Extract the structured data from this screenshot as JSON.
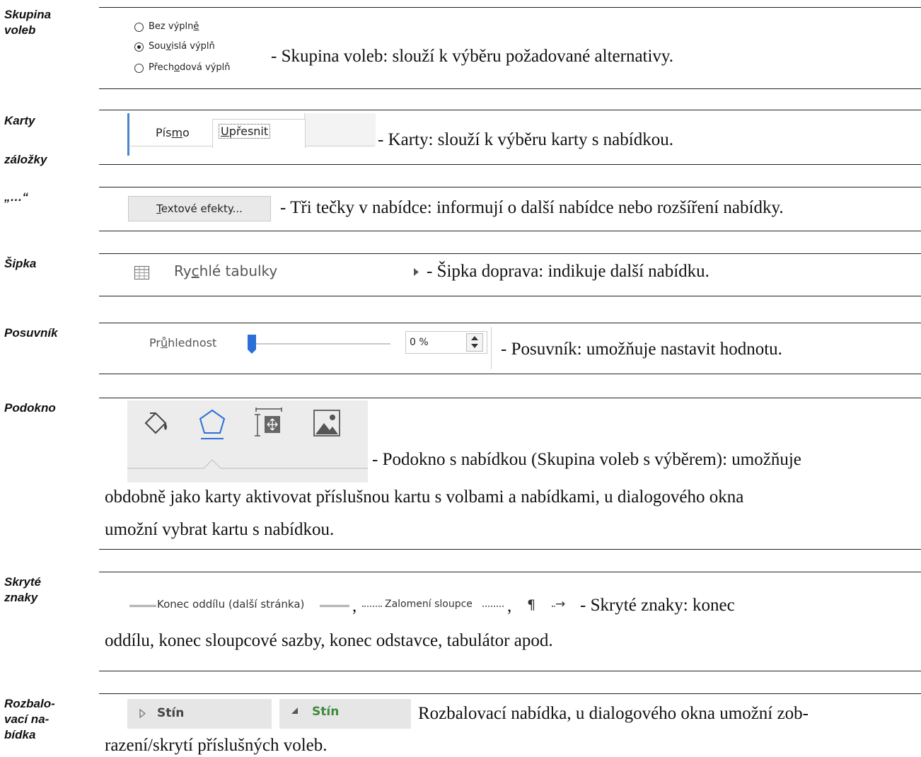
{
  "sections": [
    {
      "side_label": "Skupina\nvoleb",
      "radio_options": [
        {
          "pre": "Bez výpln",
          "u": "ě",
          "post": "",
          "selected": false
        },
        {
          "pre": "Sou",
          "u": "v",
          "post": "islá výplň",
          "selected": true
        },
        {
          "pre": "Přech",
          "u": "o",
          "post": "dová výplň",
          "selected": false
        }
      ],
      "text": "- Skupina voleb: slouží k výběru požadované alternativy."
    },
    {
      "side_label_1": "Karty",
      "side_label_2": "záložky",
      "tab_font": {
        "pre": "Pís",
        "u": "m",
        "post": "o"
      },
      "tab_advanced": {
        "pre": "",
        "u": "U",
        "post": "přesnit"
      },
      "text": "- Karty: slouží k výběru karty s nabídkou."
    },
    {
      "side_label": "„…“",
      "button": {
        "pre": "",
        "u": "T",
        "post": "extové efekty..."
      },
      "text": "- Tři tečky v nabídce: informují o další nabídce nebo rozšíření nabídky."
    },
    {
      "side_label": "Šipka",
      "menu_item": {
        "pre": "Ry",
        "u": "c",
        "post": "hlé tabulky"
      },
      "text": "- Šipka doprava: indikuje další nabídku."
    },
    {
      "side_label": "Posuvník",
      "slider_label": {
        "pre": "Pr",
        "u": "ů",
        "post": "hlednost"
      },
      "slider_value": "0 %",
      "slider_level": 0,
      "text": "- Posuvník: umožňuje nastavit hodnotu."
    },
    {
      "side_label": "Podokno",
      "icons": [
        "fill-bucket-icon",
        "pentagon-shape-icon",
        "size-properties-icon",
        "picture-icon"
      ],
      "text_line1": "- Podokno s nabídkou (Skupina voleb s výběrem): umožňuje",
      "text_line2": "obdobně jako karty aktivovat příslušnou kartu s volbami a nabídkami, u dialogového okna",
      "text_line3": "umožní vybrat kartu s nabídkou."
    },
    {
      "side_label": "Skryté\nznaky",
      "section_break": "Konec oddílu (další stránka)",
      "column_break": "Zalomení sloupce",
      "comma": ",",
      "pilcrow": "¶",
      "tab_arrow": "→",
      "text_line1": "- Skryté znaky: konec",
      "text_line2": "oddílu, konec sloupcové sazby, konec odstavce, tabulátor apod."
    },
    {
      "side_label": "Rozbalo-\nvací na-\nbídka",
      "collapsed": "Stín",
      "expanded": "Stín",
      "text_line1": "Rozbalovací nabídka, u dialogového okna umožní zob-",
      "text_line2": "razení/skrytí příslušných voleb."
    }
  ],
  "colors": {
    "accent_blue": "#2b6fd6",
    "tab_bar_blue": "#4a86c8",
    "green_text": "#3f8a3c"
  }
}
